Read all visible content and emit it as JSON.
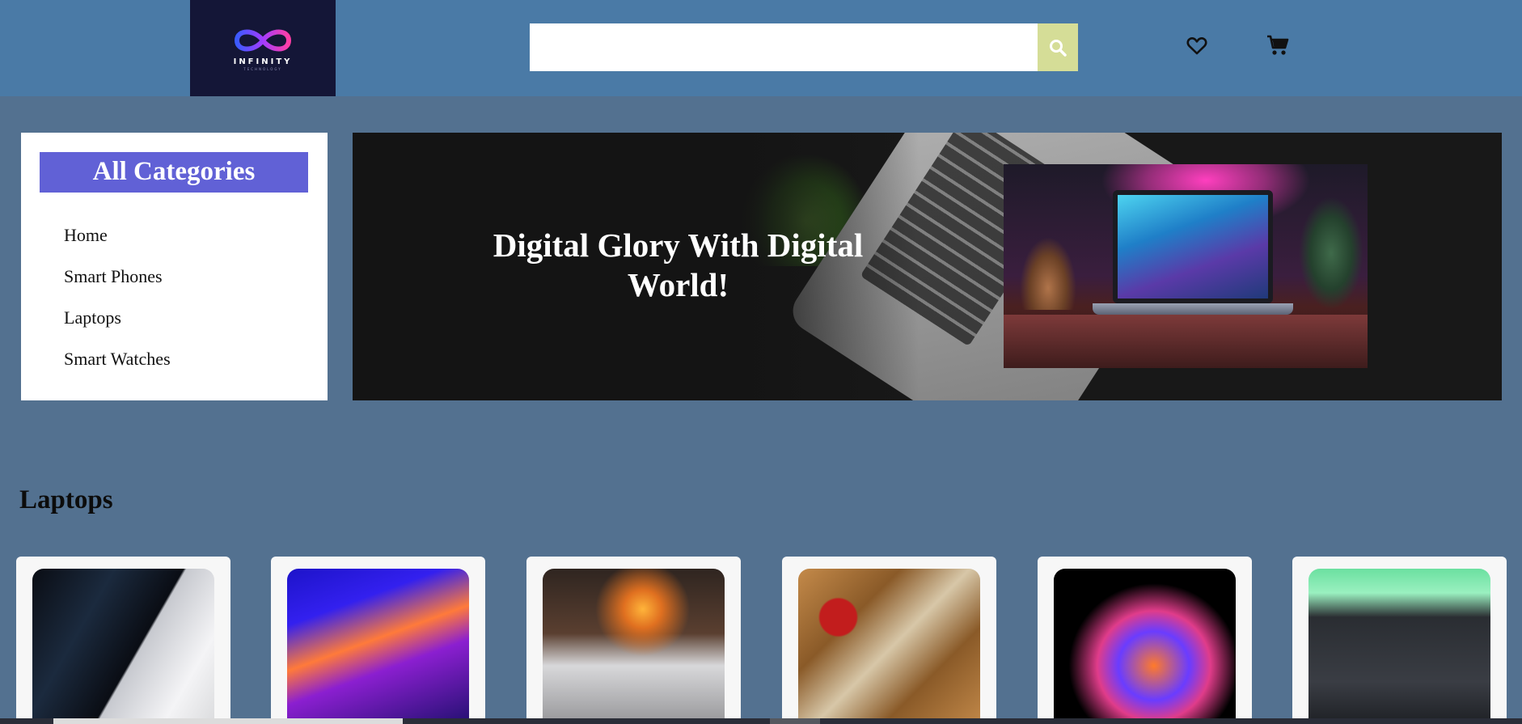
{
  "header": {
    "logo": {
      "name": "INFINITY",
      "tagline": "TECHNOLOGY"
    },
    "search": {
      "placeholder": "",
      "value": "",
      "button_icon": "search-icon"
    },
    "icons": {
      "wishlist": "heart-icon",
      "cart": "cart-icon"
    },
    "colors": {
      "header_bg": "#4a7aa6",
      "logo_bg": "#141637",
      "search_button_bg": "#d5dd97"
    }
  },
  "sidebar": {
    "title": "All Categories",
    "items": [
      {
        "label": "Home"
      },
      {
        "label": "Smart Phones"
      },
      {
        "label": "Laptops"
      },
      {
        "label": "Smart Watches"
      }
    ],
    "colors": {
      "title_bg": "#6161d6"
    }
  },
  "banner": {
    "heading": "Digital Glory With Digital World!"
  },
  "section": {
    "title": "Laptops",
    "products": [
      {
        "image": "laptop-photo-silver-pair"
      },
      {
        "image": "laptop-photo-neon-gaming-setup"
      },
      {
        "image": "laptop-photo-sunset-screen-coffee"
      },
      {
        "image": "laptop-photo-wood-desk-headphones"
      },
      {
        "image": "laptop-photo-glowing-dark"
      },
      {
        "image": "laptop-photo-space-gray"
      }
    ]
  },
  "page": {
    "background": "#537190"
  }
}
